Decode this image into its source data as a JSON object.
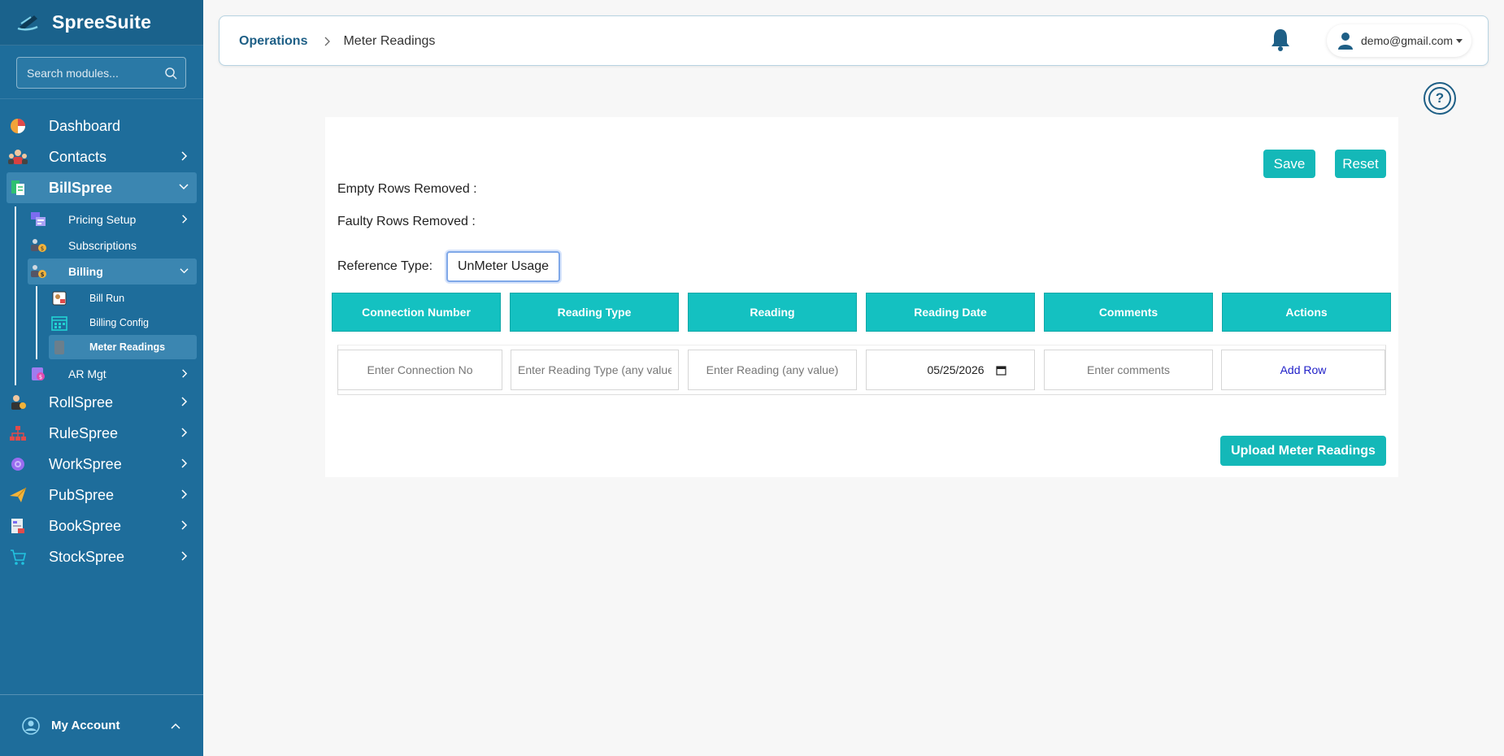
{
  "sidebar": {
    "brand": "SpreeSuite",
    "search_placeholder": "Search modules...",
    "items": [
      {
        "label": "Dashboard"
      },
      {
        "label": "Contacts"
      },
      {
        "label": "BillSpree"
      },
      {
        "label": "RollSpree"
      },
      {
        "label": "RuleSpree"
      },
      {
        "label": "WorkSpree"
      },
      {
        "label": "PubSpree"
      },
      {
        "label": "BookSpree"
      },
      {
        "label": "StockSpree"
      }
    ],
    "billspree_sub": [
      {
        "label": "Pricing Setup"
      },
      {
        "label": "Subscriptions"
      },
      {
        "label": "Billing"
      },
      {
        "label": "AR Mgt"
      }
    ],
    "billing_sub": [
      {
        "label": "Bill Run"
      },
      {
        "label": "Billing Config"
      },
      {
        "label": "Meter Readings"
      }
    ],
    "account": "My Account"
  },
  "header": {
    "breadcrumb_root": "Operations",
    "breadcrumb_current": "Meter Readings",
    "user_email": "demo@gmail.com"
  },
  "help": "?",
  "form": {
    "save_label": "Save",
    "reset_label": "Reset",
    "empty_rows_label": "Empty Rows Removed :",
    "faulty_rows_label": "Faulty Rows Removed :",
    "reference_type_label": "Reference Type:",
    "reference_type_value": "UnMeter Usage",
    "columns": [
      "Connection Number",
      "Reading Type",
      "Reading",
      "Reading Date",
      "Comments",
      "Actions"
    ],
    "row": {
      "connection_placeholder": "Enter Connection No",
      "reading_type_placeholder": "Enter Reading Type (any value)",
      "reading_placeholder": "Enter Reading (any value)",
      "date_value": "05/25/2026",
      "comments_placeholder": "Enter comments",
      "action_label": "Add Row"
    },
    "upload_label": "Upload Meter Readings"
  },
  "colors": {
    "sidebar": "#1e6d9b",
    "accent": "#14b8b8",
    "link": "#2020c8"
  }
}
